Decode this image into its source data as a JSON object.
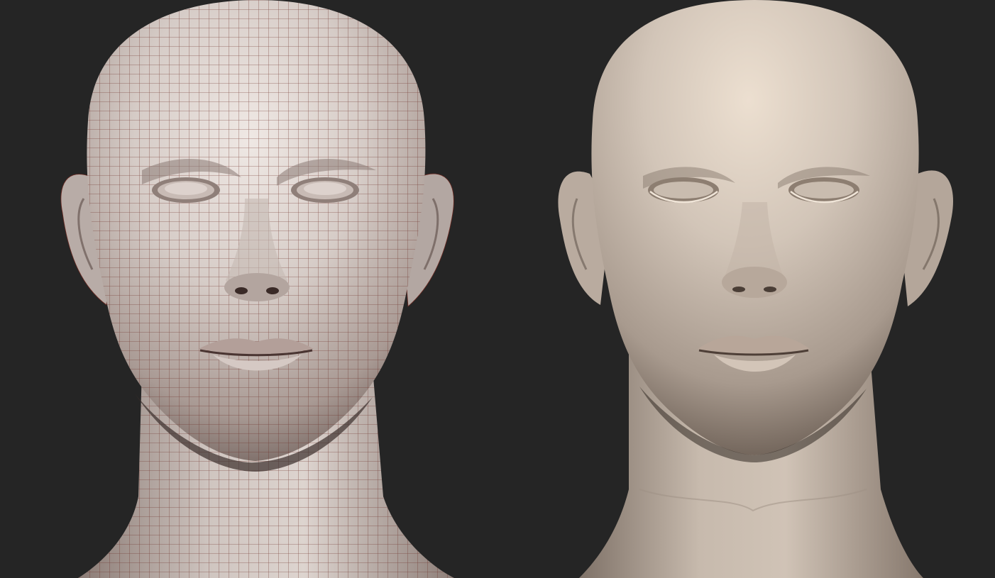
{
  "scene": {
    "background_color": "#252525",
    "left_panel": {
      "kind": "wireframe-base-mesh-head",
      "surface_color": "#d9d0cb",
      "wire_color": "#6b2a22"
    },
    "right_panel": {
      "kind": "sculpted-detailed-head",
      "surface_color": "#cfc3b6"
    }
  }
}
